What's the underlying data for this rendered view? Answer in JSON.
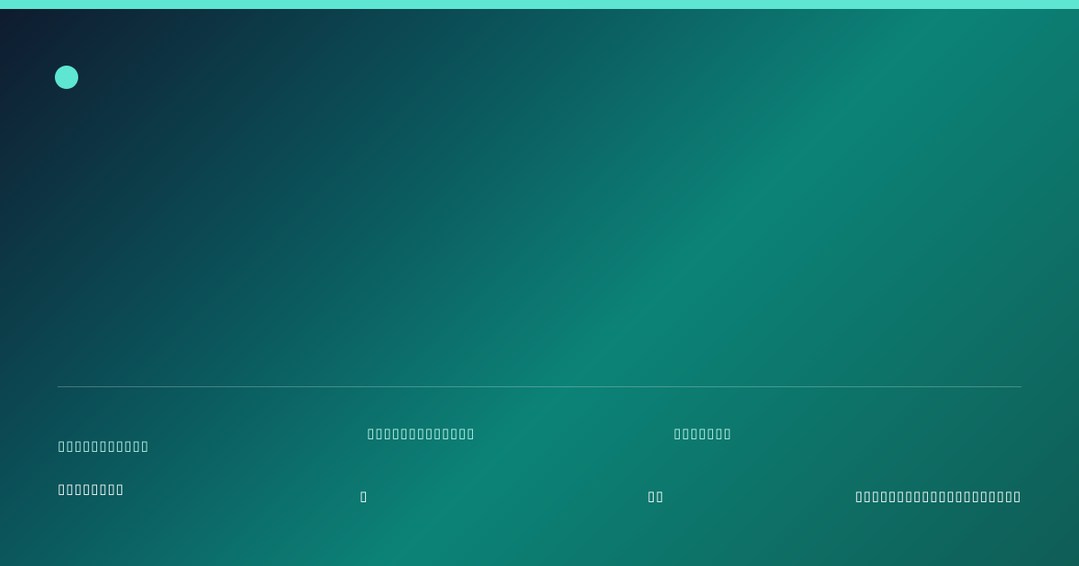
{
  "theme": {
    "accent": "#5ee6d2",
    "gradient_dark": "#0f1a2e",
    "gradient_mid": "#0c8377"
  },
  "footer": {
    "brand_name": "▯▯▯▯▯▯▯▯▯▯▯",
    "brand_tagline": "▯▯▯▯▯▯▯▯",
    "columns": [
      {
        "label": "▯▯▯▯▯▯▯▯▯▯▯▯▯",
        "value": "▯"
      },
      {
        "label": "▯▯▯▯▯▯▯",
        "value": "▯▯"
      }
    ],
    "right_text": "▯▯▯▯▯▯▯▯▯▯▯▯▯▯▯▯▯▯▯▯"
  }
}
